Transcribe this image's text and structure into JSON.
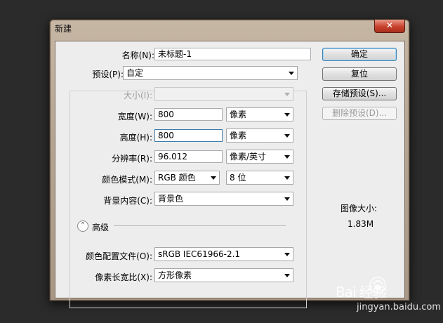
{
  "window": {
    "title": "新建",
    "close_label": "✕"
  },
  "form": {
    "name": {
      "label": "名称(N):",
      "value": "未标题-1"
    },
    "preset": {
      "label": "预设(P):",
      "value": "自定"
    },
    "size": {
      "label": "大小(I):",
      "value": ""
    },
    "width": {
      "label": "宽度(W):",
      "value": "800",
      "unit": "像素"
    },
    "height": {
      "label": "高度(H):",
      "value": "800",
      "unit": "像素"
    },
    "resolution": {
      "label": "分辨率(R):",
      "value": "96.012",
      "unit": "像素/英寸"
    },
    "color_mode": {
      "label": "颜色模式(M):",
      "value": "RGB 颜色",
      "bits": "8 位"
    },
    "background": {
      "label": "背景内容(C):",
      "value": "背景色"
    },
    "advanced": {
      "label": "高级",
      "toggle_glyph": "⌃"
    },
    "color_profile": {
      "label": "颜色配置文件(O):",
      "value": "sRGB IEC61966-2.1"
    },
    "pixel_aspect": {
      "label": "像素长宽比(X):",
      "value": "方形像素"
    }
  },
  "buttons": {
    "ok": "确定",
    "reset": "复位",
    "save_preset": "存储预设(S)...",
    "delete_preset": "删除预设(D)..."
  },
  "image_size": {
    "label": "图像大小:",
    "value": "1.83M"
  },
  "watermark": {
    "brand": "Bai 经验",
    "url": "jingyan.baidu.com"
  }
}
